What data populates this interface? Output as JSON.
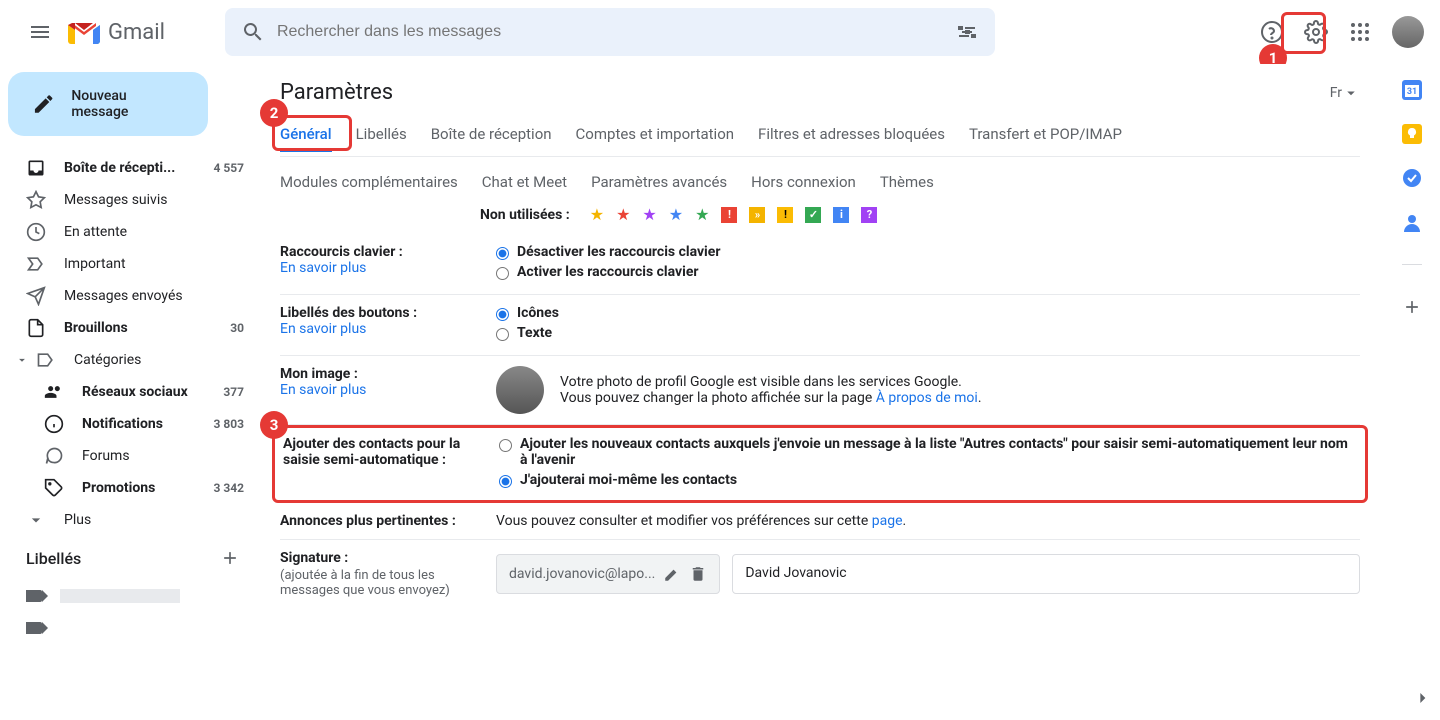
{
  "header": {
    "logo_text": "Gmail",
    "search_placeholder": "Rechercher dans les messages"
  },
  "sidebar": {
    "compose": "Nouveau message",
    "items": [
      {
        "icon": "inbox",
        "label": "Boîte de récepti...",
        "count": "4 557",
        "bold": true
      },
      {
        "icon": "star",
        "label": "Messages suivis",
        "count": "",
        "bold": false
      },
      {
        "icon": "clock",
        "label": "En attente",
        "count": "",
        "bold": false
      },
      {
        "icon": "important",
        "label": "Important",
        "count": "",
        "bold": false
      },
      {
        "icon": "sent",
        "label": "Messages envoyés",
        "count": "",
        "bold": false
      },
      {
        "icon": "draft",
        "label": "Brouillons",
        "count": "30",
        "bold": true
      },
      {
        "icon": "category",
        "label": "Catégories",
        "count": "",
        "bold": false,
        "expandable": true
      }
    ],
    "categories": [
      {
        "icon": "people",
        "label": "Réseaux sociaux",
        "count": "377",
        "bold": true
      },
      {
        "icon": "info",
        "label": "Notifications",
        "count": "3 803",
        "bold": true
      },
      {
        "icon": "forum",
        "label": "Forums",
        "count": "",
        "bold": false
      },
      {
        "icon": "tag",
        "label": "Promotions",
        "count": "3 342",
        "bold": true
      }
    ],
    "more": "Plus",
    "labels_header": "Libellés"
  },
  "settings": {
    "title": "Paramètres",
    "lang_display": "Fr",
    "tabs1": [
      "Général",
      "Libellés",
      "Boîte de réception",
      "Comptes et importation",
      "Filtres et adresses bloquées",
      "Transfert et POP/IMAP"
    ],
    "tabs2": [
      "Modules complémentaires",
      "Chat et Meet",
      "Paramètres avancés",
      "Hors connexion",
      "Thèmes"
    ],
    "stars_unused_label": "Non utilisées :",
    "rows": {
      "shortcuts": {
        "label": "Raccourcis clavier :",
        "learn": "En savoir plus",
        "opt1": "Désactiver les raccourcis clavier",
        "opt2": "Activer les raccourcis clavier"
      },
      "buttonlabels": {
        "label": "Libellés des boutons :",
        "learn": "En savoir plus",
        "opt1": "Icônes",
        "opt2": "Texte"
      },
      "image": {
        "label": "Mon image :",
        "learn": "En savoir plus",
        "text1": "Votre photo de profil Google est visible dans les services Google.",
        "text2": "Vous pouvez changer la photo affichée sur la page ",
        "link": "À propos de moi"
      },
      "autocontacts": {
        "label": "Ajouter des contacts pour la saisie semi-automatique :",
        "opt1": "Ajouter les nouveaux contacts auxquels j'envoie un message à la liste \"Autres contacts\" pour saisir semi-automatiquement leur nom à l'avenir",
        "opt2": "J'ajouterai moi-même les contacts"
      },
      "ads": {
        "label": "Annonces plus pertinentes :",
        "text": "Vous pouvez consulter et modifier vos préférences sur cette ",
        "link": "page"
      },
      "signature": {
        "label": "Signature :",
        "sublabel": "(ajoutée à la fin de tous les messages que vous envoyez)",
        "sig_name": "david.jovanovic@lapo...",
        "sig_text": "David Jovanovic"
      }
    }
  },
  "callouts": {
    "c1": "1",
    "c2": "2",
    "c3": "3"
  }
}
